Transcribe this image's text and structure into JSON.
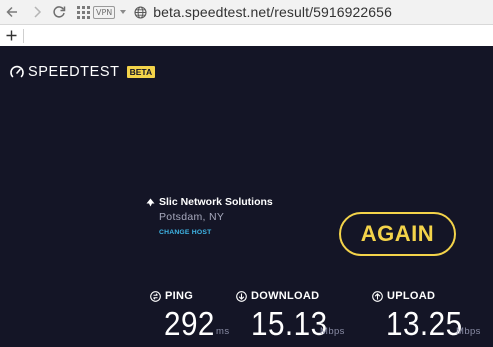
{
  "browser": {
    "vpn_badge": "VPN",
    "url": "beta.speedtest.net/result/5916922656",
    "new_tab": "+"
  },
  "app": {
    "brand": "SPEEDTEST",
    "brand_badge": "BETA",
    "isp_name": "Slic Network Solutions",
    "isp_location": "Potsdam, NY",
    "change_host": "CHANGE HOST",
    "again_button": "AGAIN"
  },
  "results": {
    "ping": {
      "label": "PING",
      "value": "292",
      "unit": "ms"
    },
    "download": {
      "label": "DOWNLOAD",
      "value": "15.13",
      "unit": "Mbps"
    },
    "upload": {
      "label": "UPLOAD",
      "value": "13.25",
      "unit": "Mbps"
    }
  },
  "colors": {
    "page_bg": "#141526",
    "accent": "#f3d34a",
    "link": "#3fb6e7"
  }
}
